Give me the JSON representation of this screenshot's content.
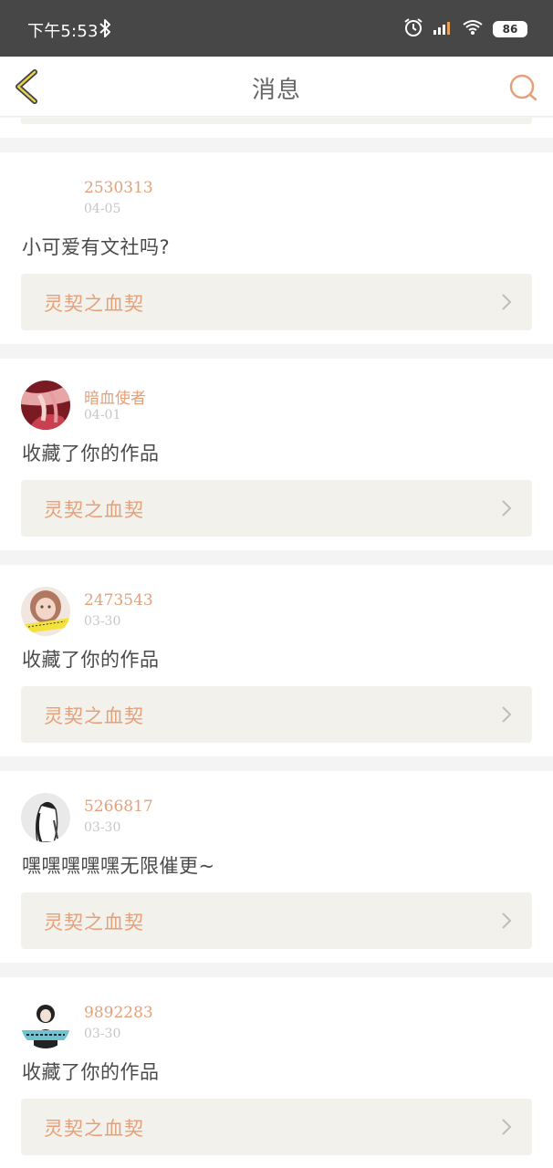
{
  "status_bar": {
    "time": "下午5:53",
    "battery": "86"
  },
  "header": {
    "title": "消息",
    "back_icon": "chevron-left-icon",
    "search_icon": "search-icon"
  },
  "colors": {
    "accent": "#e6a079",
    "status_bg": "#474747",
    "card_bg": "#ffffff",
    "work_bg": "#f3f1eb",
    "page_bg": "#f4f4f4"
  },
  "messages": [
    {
      "user": "2530313",
      "date": "04-05",
      "text": "小可爱有文社吗?",
      "work": "灵契之血契"
    },
    {
      "user": "暗血使者",
      "date": "04-01",
      "text": "收藏了你的作品",
      "work": "灵契之血契"
    },
    {
      "user": "2473543",
      "date": "03-30",
      "text": "收藏了你的作品",
      "work": "灵契之血契"
    },
    {
      "user": "5266817",
      "date": "03-30",
      "text": "嘿嘿嘿嘿嘿无限催更~",
      "work": "灵契之血契"
    },
    {
      "user": "9892283",
      "date": "03-30",
      "text": "收藏了你的作品",
      "work": "灵契之血契"
    }
  ]
}
